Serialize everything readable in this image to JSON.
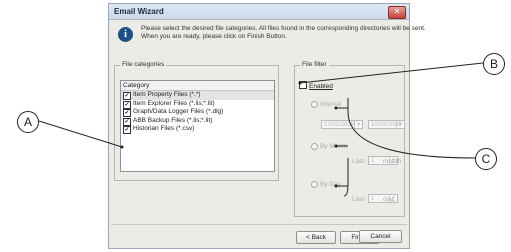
{
  "window": {
    "title": "Email Wizard",
    "close_glyph": "✕"
  },
  "description": {
    "line1": "Please select the desired file categories. All files found in the corresponding directories will be sent.",
    "line2": "When you are ready, please click on Finish Button."
  },
  "file_categories": {
    "label": "File categories",
    "column_header": "Category",
    "items": [
      {
        "label": "Item Property Files (*.*)",
        "checked": true
      },
      {
        "label": "Item Explorer Files (*.lis;*.lit)",
        "checked": true
      },
      {
        "label": "Graph/Data Logger Files (*.dlg)",
        "checked": true
      },
      {
        "label": "ABB Backup Files (*.lis;*.lit)",
        "checked": true
      },
      {
        "label": "Historian Files (*.csv)",
        "checked": true
      }
    ]
  },
  "file_filter": {
    "label": "File filter",
    "enabled_label": "Enabled",
    "enabled_checked": false,
    "interval_label": "Interval",
    "date_from": "02/02/2009",
    "date_to": "10/02/2009",
    "by_month_label": "By Month",
    "last_label_1": "Last",
    "month_value": "1",
    "month_unit": "month",
    "by_day_label": "By Day",
    "last_label_2": "Last",
    "day_value": "1",
    "day_unit": "day"
  },
  "buttons": {
    "back": "< Back",
    "finish": "Finish",
    "cancel": "Cancel"
  },
  "callouts": {
    "a": "A",
    "b": "B",
    "c": "C"
  },
  "colors": {
    "info_icon": "#1e4f86",
    "close_button": "#c4433a"
  }
}
